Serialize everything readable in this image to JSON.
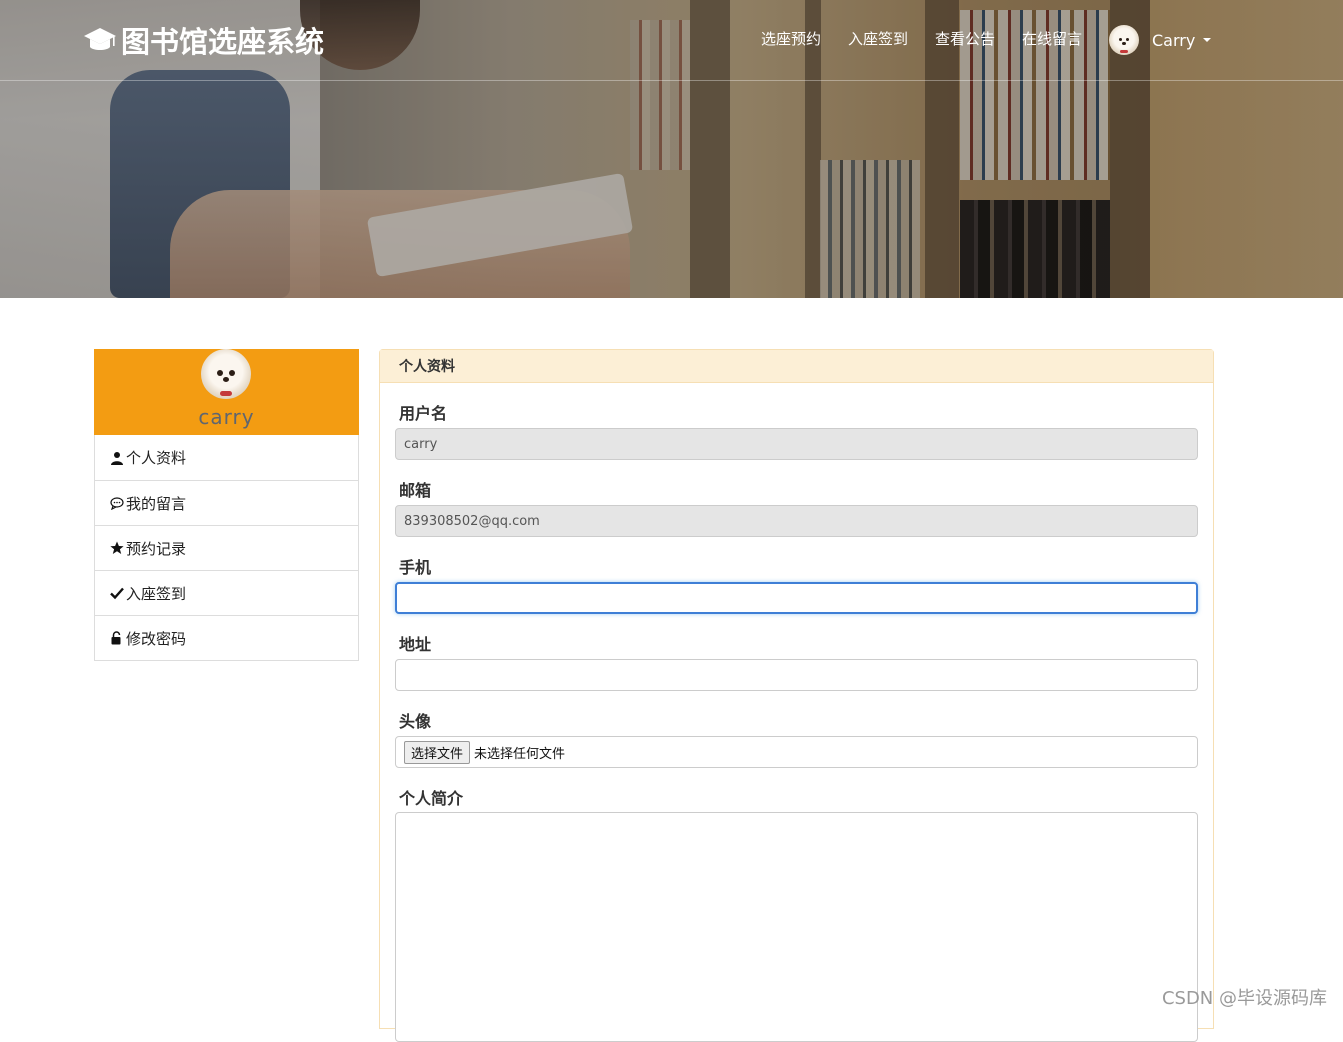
{
  "header": {
    "brand_title": "图书馆选座系统",
    "nav_items": [
      "选座预约",
      "入座签到",
      "查看公告",
      "在线留言"
    ],
    "user_name": "Carry"
  },
  "sidebar": {
    "profile_name": "carry",
    "items": [
      {
        "label": "个人资料",
        "icon": "user-icon"
      },
      {
        "label": "我的留言",
        "icon": "comment-icon"
      },
      {
        "label": "预约记录",
        "icon": "star-icon"
      },
      {
        "label": "入座签到",
        "icon": "check-icon"
      },
      {
        "label": "修改密码",
        "icon": "lock-icon"
      }
    ]
  },
  "panel": {
    "title": "个人资料",
    "fields": {
      "username": {
        "label": "用户名",
        "value": "carry"
      },
      "email": {
        "label": "邮箱",
        "value": "839308502@qq.com"
      },
      "phone": {
        "label": "手机",
        "value": ""
      },
      "address": {
        "label": "地址",
        "value": ""
      },
      "avatar": {
        "label": "头像",
        "button": "选择文件",
        "status": "未选择任何文件"
      },
      "bio": {
        "label": "个人简介",
        "value": ""
      }
    }
  },
  "watermark": "CSDN @毕设源码库",
  "colors": {
    "accent": "#f39c12",
    "panel_heading": "#fcefd6",
    "focus": "#3f7fd6"
  }
}
